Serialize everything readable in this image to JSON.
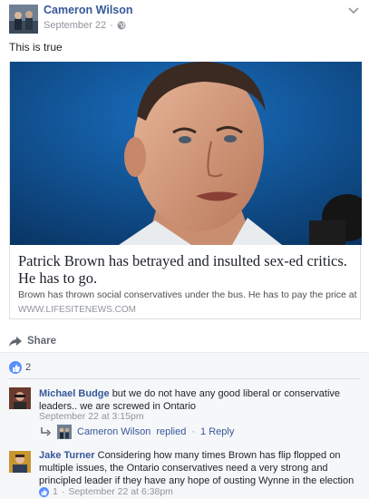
{
  "post": {
    "author": "Cameron Wilson",
    "date": "September 22",
    "text": "This is true"
  },
  "link": {
    "title": "Patrick Brown has betrayed and insulted sex-ed critics. He has to go.",
    "description": "Brown has thrown social conservatives under the bus. He has to pay the price at the...",
    "domain": "WWW.LIFESITENEWS.COM"
  },
  "actions": {
    "share": "Share"
  },
  "reactions": {
    "count": "2"
  },
  "comments": [
    {
      "author": "Michael Budge",
      "text": "but we do not have any good liberal or conservative leaders.. we are screwed in Ontario",
      "time": "September 22 at 3:15pm",
      "reply": {
        "author": "Cameron Wilson",
        "replied": "replied",
        "count": "1 Reply"
      }
    },
    {
      "author": "Jake Turner",
      "text": "Considering how many times Brown has flip flopped on multiple issues, the Ontario conservatives need a very strong and principled leader if they have any hope of ousting Wynne in the election",
      "likes": "1",
      "time": "September 22 at 6:38pm"
    }
  ],
  "colors": {
    "link_blue": "#365899",
    "like_blue": "#5890ff",
    "secondary_text": "#90949c"
  }
}
